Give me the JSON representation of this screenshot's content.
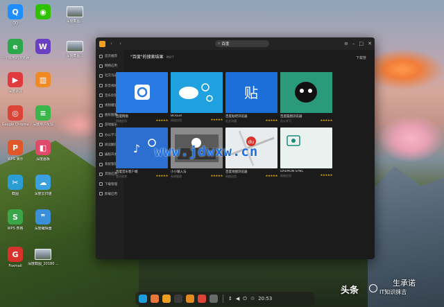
{
  "desktop": {
    "icons": [
      {
        "label": "QQ",
        "icon": "qq-icon",
        "color": "#1f8fff",
        "glyph": "Q"
      },
      {
        "label": "",
        "icon": "wechat-icon",
        "color": "#2dc100",
        "glyph": "◉"
      },
      {
        "label": "深度截图...",
        "icon": "screenshot-thumb-icon",
        "color": "",
        "glyph": ""
      },
      {
        "label": "一个好用的浏览器",
        "icon": "browser-e-icon",
        "color": "#2aa84a",
        "glyph": "e"
      },
      {
        "label": "",
        "icon": "wps-writer-icon",
        "color": "#6a3fc2",
        "glyph": "W"
      },
      {
        "label": "深度截图...",
        "icon": "screenshot-thumb-icon",
        "color": "",
        "glyph": ""
      },
      {
        "label": "深度录屏",
        "icon": "screen-recorder-icon",
        "color": "#e0393e",
        "glyph": "▶"
      },
      {
        "label": "",
        "icon": "archive-icon",
        "color": "#f08a24",
        "glyph": "▥"
      },
      {
        "label": "Google Chrome",
        "icon": "chrome-icon",
        "color": "#db4437",
        "glyph": "◎"
      },
      {
        "label": "深度用户反馈",
        "icon": "feedback-icon",
        "color": "#39b54a",
        "glyph": "≡"
      },
      {
        "label": "WPS 演示",
        "icon": "wps-presentation-icon",
        "color": "#e0572a",
        "glyph": "P"
      },
      {
        "label": "深度画板",
        "icon": "draw-icon",
        "color": "#e04a6a",
        "glyph": "◧"
      },
      {
        "label": "截图",
        "icon": "capture-icon",
        "color": "#2a9dd4",
        "glyph": "✂"
      },
      {
        "label": "深度云扫描",
        "icon": "cloud-scan-icon",
        "color": "#3aa0e0",
        "glyph": "☁"
      },
      {
        "label": "WPS 表格",
        "icon": "wps-sheet-icon",
        "color": "#3aa648",
        "glyph": "S"
      },
      {
        "label": "深度编辑器",
        "icon": "editor-icon",
        "color": "#3b8fd9",
        "glyph": "❞"
      },
      {
        "label": "Foxmail",
        "icon": "foxmail-icon",
        "color": "#d8322c",
        "glyph": "G"
      },
      {
        "label": "深度截图_20180 ... 49.png",
        "icon": "screenshot-file-icon",
        "color": "",
        "glyph": ""
      }
    ]
  },
  "window": {
    "search_text": "百度",
    "title": "\"百度\"的搜索结果",
    "count": "共8个",
    "download_label": "下载管",
    "sidebar": [
      {
        "label": "首页推荐",
        "icon": "home-icon"
      },
      {
        "label": "网络应用",
        "icon": "network-icon"
      },
      {
        "label": "社交沟通",
        "icon": "chat-icon"
      },
      {
        "label": "影音视听",
        "icon": "media-icon"
      },
      {
        "label": "音乐欣赏",
        "icon": "music-icon"
      },
      {
        "label": "视频播放",
        "icon": "video-icon"
      },
      {
        "label": "图形图像",
        "icon": "image-icon"
      },
      {
        "label": "游戏娱乐",
        "icon": "game-icon"
      },
      {
        "label": "办公学习",
        "icon": "office-icon"
      },
      {
        "label": "阅读翻译",
        "icon": "read-icon"
      },
      {
        "label": "编程开发",
        "icon": "code-icon"
      },
      {
        "label": "系统管理",
        "icon": "system-icon"
      },
      {
        "label": "其他应用",
        "icon": "other-icon"
      },
      {
        "label": "下载管理",
        "icon": "download-icon"
      },
      {
        "label": "卸载应用",
        "icon": "uninstall-icon"
      }
    ],
    "results": [
      {
        "name": "百度网盘",
        "sub": "网络应用",
        "stars": "★★★★★",
        "bg": "#2a7ae4",
        "accent": "#ffffff",
        "art": "cloud-disk"
      },
      {
        "name": "BCloud",
        "sub": "网络应用",
        "stars": "★★★★★",
        "bg": "#1fa0df",
        "accent": "#ffffff",
        "art": "bcloud"
      },
      {
        "name": "百度贴吧浏览器",
        "sub": "社交沟通",
        "stars": "★★★★★",
        "bg": "#1c6fd8",
        "accent": "#ffffff",
        "art": "tieba"
      },
      {
        "name": "百度脑图浏览器",
        "sub": "办公学习",
        "stars": "★★★★★",
        "bg": "#2a9a7a",
        "accent": "#111111",
        "art": "mindmap"
      },
      {
        "name": "百度音乐客户端",
        "sub": "音乐欣赏",
        "stars": "★★★★★",
        "bg": "#2d6fd0",
        "accent": "#ffffff",
        "art": "music"
      },
      {
        "name": "小小输入法",
        "sub": "系统管理",
        "stars": "★★★★★",
        "bg": "#8a8a8a",
        "accent": "#ffffff",
        "art": "ime"
      },
      {
        "name": "百度地图浏览器",
        "sub": "网络应用",
        "stars": "★★★★★",
        "bg": "#e8ecef",
        "accent": "#d9342b",
        "art": "map"
      },
      {
        "name": "DAEMON SYNC",
        "sub": "网络应用",
        "stars": "★★★★★",
        "bg": "#e9f2ef",
        "accent": "#1a8a7a",
        "art": "sync"
      }
    ]
  },
  "watermark": "www.jdwxw.cn",
  "dock": {
    "items": [
      {
        "name": "launcher-icon",
        "color": "#1d9bdd"
      },
      {
        "name": "browser-icon",
        "color": "#e8783a"
      },
      {
        "name": "files-icon",
        "color": "#f0a020"
      },
      {
        "name": "terminal-icon",
        "color": "#3b3b3b"
      },
      {
        "name": "app-store-icon",
        "color": "#e08a20"
      },
      {
        "name": "chrome-icon",
        "color": "#db4437"
      },
      {
        "name": "settings-icon",
        "color": "#6a6a6a"
      }
    ],
    "tray": [
      {
        "name": "network-tray-icon",
        "glyph": "↕"
      },
      {
        "name": "volume-tray-icon",
        "glyph": "◀"
      },
      {
        "name": "power-tray-icon",
        "glyph": "⏻"
      },
      {
        "name": "trash-tray-icon",
        "glyph": "♲"
      }
    ],
    "time": "20:53"
  },
  "brand": {
    "main": "头条",
    "sub": "IT知识抹吉",
    "sub2": "生承诺"
  }
}
